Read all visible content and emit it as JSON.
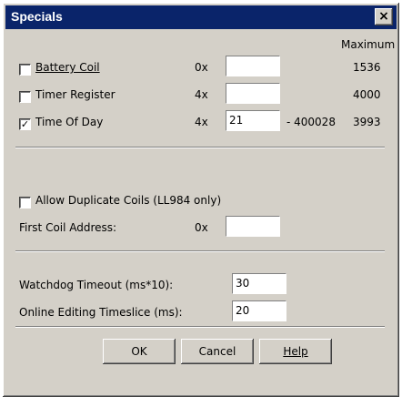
{
  "window": {
    "title": "Specials",
    "close_label": "×"
  },
  "header": {
    "maximum_label": "Maximum"
  },
  "rows": [
    {
      "label": "Battery Coil",
      "checked": false,
      "prefix": "0x",
      "value": "",
      "range_text": "",
      "maximum": "1536"
    },
    {
      "label": "Timer Register",
      "checked": false,
      "prefix": "4x",
      "value": "",
      "range_text": "",
      "maximum": "4000"
    },
    {
      "label": "Time Of Day",
      "checked": true,
      "prefix": "4x",
      "value": "21",
      "range_text": "- 400028",
      "maximum": "3993"
    }
  ],
  "coils": {
    "allow_duplicate_label": "Allow Duplicate Coils (LL984 only)",
    "allow_duplicate_checked": false,
    "first_coil_label": "First Coil Address:",
    "first_coil_prefix": "0x",
    "first_coil_value": ""
  },
  "timing": {
    "watchdog_label": "Watchdog Timeout (ms*10):",
    "watchdog_value": "30",
    "online_label": "Online Editing Timeslice (ms):",
    "online_value": "20"
  },
  "buttons": {
    "ok": "OK",
    "cancel": "Cancel",
    "help": "Help"
  }
}
